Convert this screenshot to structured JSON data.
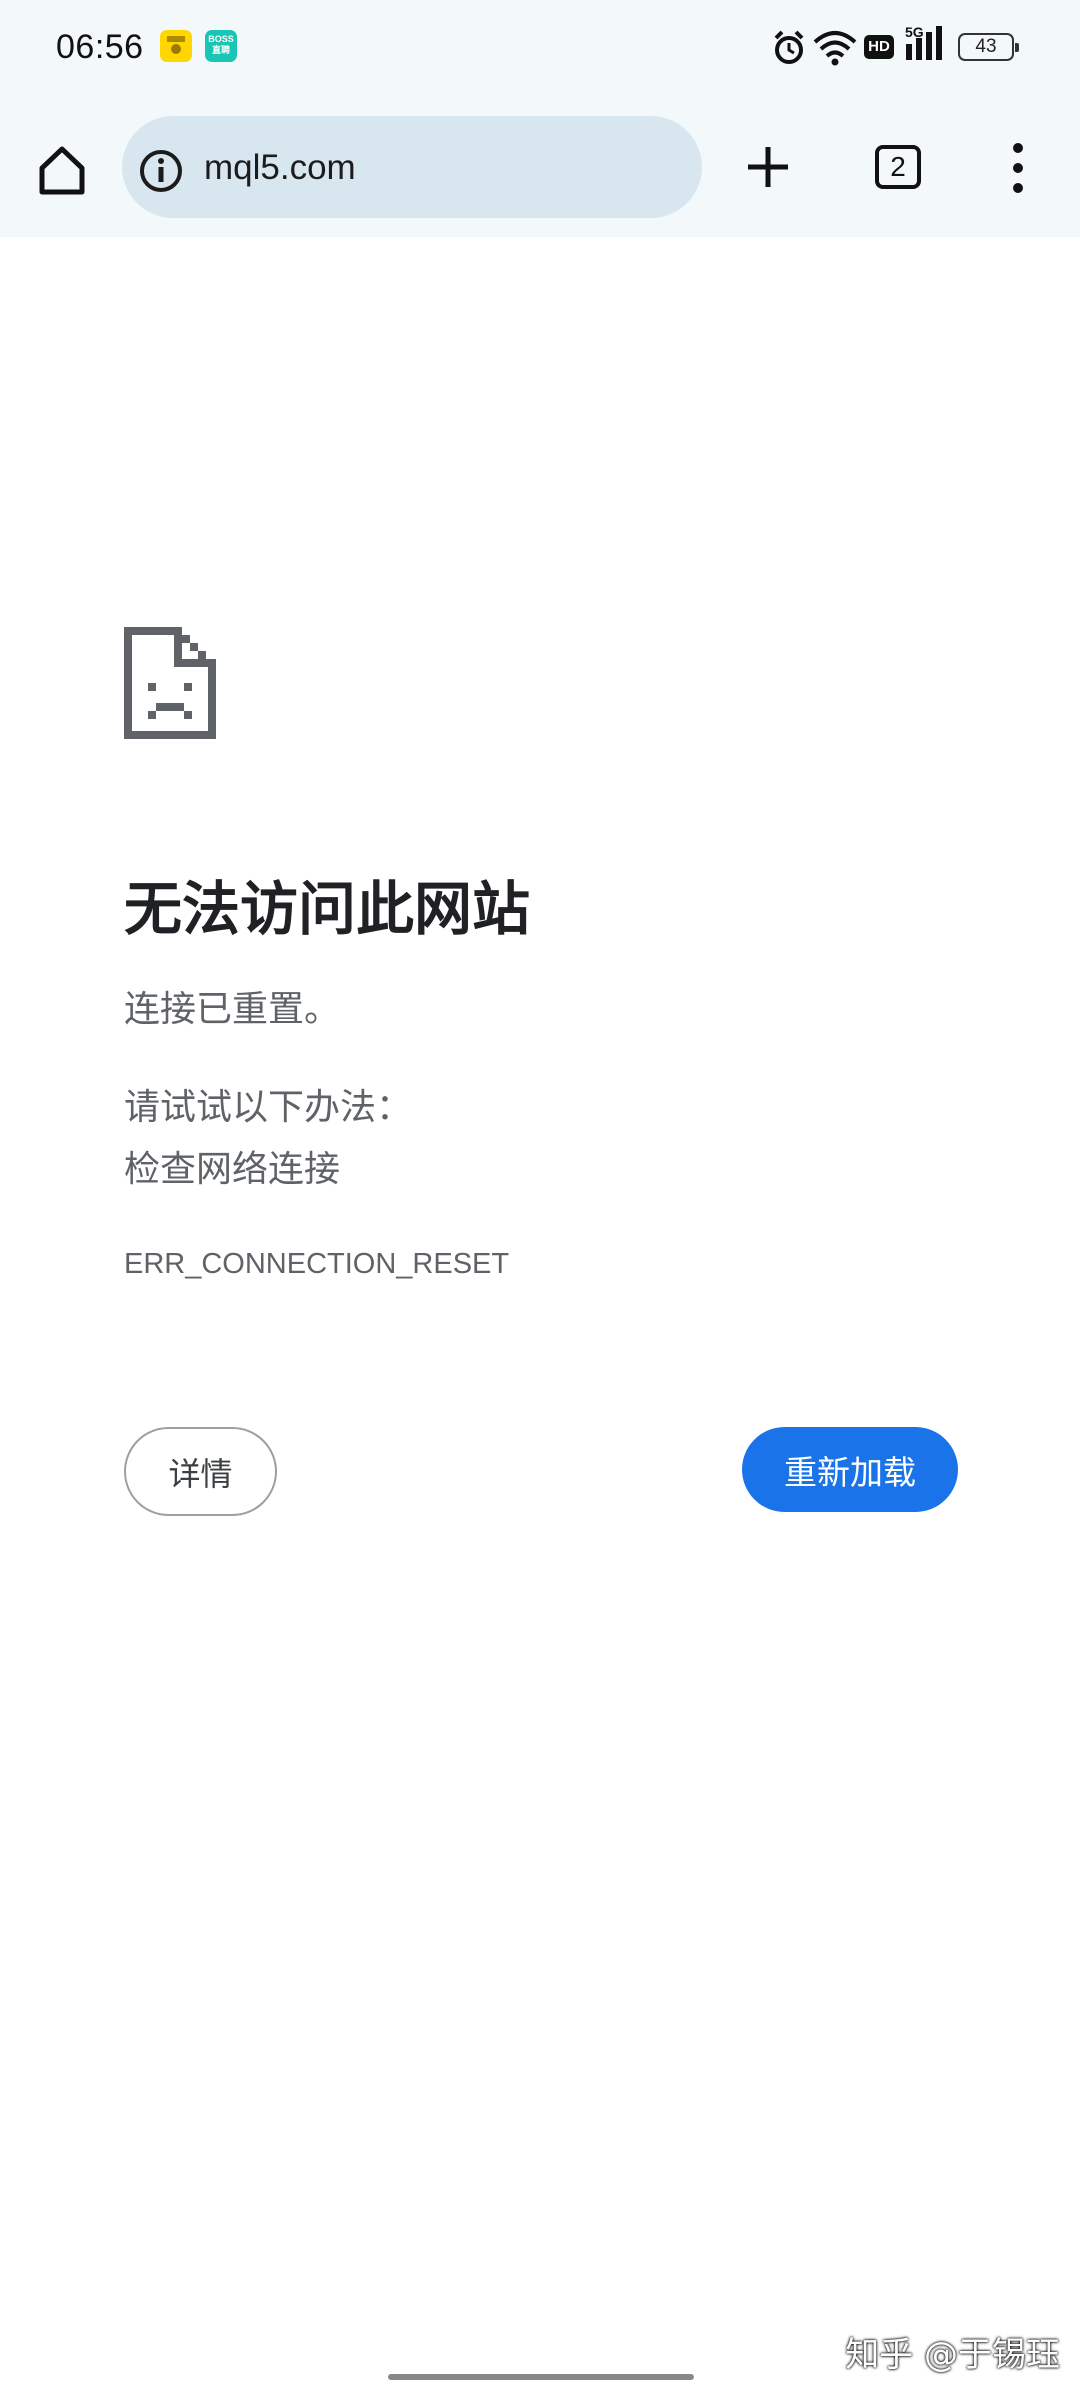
{
  "status_bar": {
    "time": "06:56",
    "app_icons": [
      {
        "name": "yellow-app-icon",
        "text": "",
        "color": "#ffd600"
      },
      {
        "name": "boss-zhipin-icon",
        "text": "BOSS\n直聘",
        "color": "#19c5b4"
      }
    ],
    "indicators": [
      "alarm-icon",
      "wifi-icon",
      "hd-icon",
      "5g-signal-icon"
    ],
    "hd_label": "HD",
    "network_label": "5G",
    "battery_level": "43"
  },
  "toolbar": {
    "url": "mql5.com",
    "tab_count": "2",
    "omnibox_color": "#d7e6ef"
  },
  "error": {
    "icon": "sad-page-icon",
    "title": "无法访问此网站",
    "description": "连接已重置。",
    "suggestion_heading": "请试试以下办法：",
    "suggestion_item": "检查网络连接",
    "error_code": "ERR_CONNECTION_RESET",
    "details_label": "详情",
    "reload_label": "重新加载",
    "accent_color": "#1a73e8"
  },
  "watermark": "知乎 @于锡珏"
}
